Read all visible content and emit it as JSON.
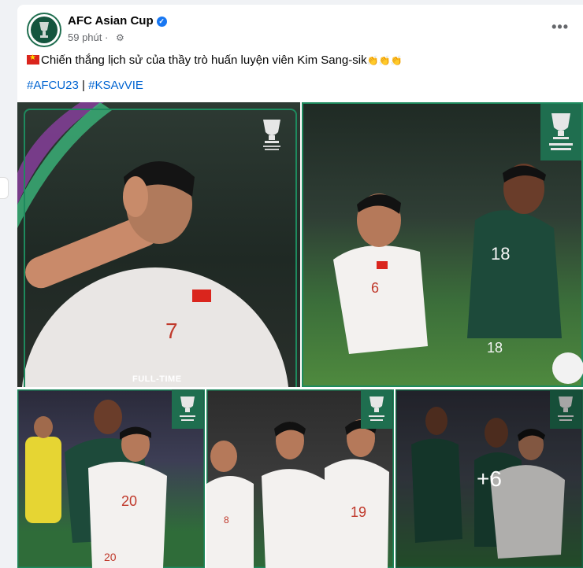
{
  "post": {
    "page_name": "AFC Asian Cup",
    "time": "59 phút",
    "caption": "Chiến thắng lịch sử của thầy trò huấn luyện viên Kim Sang-sik",
    "hashtags": [
      "#AFCU23",
      "#KSAvVIE"
    ],
    "hashtag_separator": "|"
  },
  "photos": {
    "fulltime_label": "FULL-TIME",
    "more_count": "+6",
    "jersey_numbers": {
      "p1": "7",
      "p2_white": "6",
      "p2_green": "18",
      "p3": "20",
      "p4_a": "19",
      "p4_b": "8"
    }
  },
  "icons": {
    "verified": "verified-badge-icon",
    "privacy": "gear-icon",
    "more": "more-options-icon"
  },
  "colors": {
    "link": "#0064d1",
    "verified": "#1877f2",
    "afc_green": "#1f6e4f"
  }
}
